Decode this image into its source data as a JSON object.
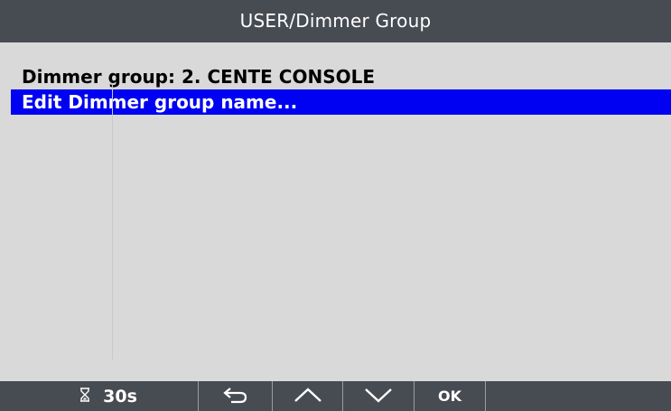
{
  "header": {
    "title": "USER/Dimmer Group"
  },
  "menu": {
    "items": [
      {
        "label": "Dimmer group: 2. CENTE CONSOLE",
        "selected": false
      },
      {
        "label": "Edit Dimmer group name...",
        "selected": true
      }
    ]
  },
  "footer": {
    "timer_icon": "hourglass-icon",
    "timer_value": "30s",
    "back_icon": "back-arrow-icon",
    "up_icon": "chevron-up-icon",
    "down_icon": "chevron-down-icon",
    "ok_label": "OK"
  },
  "colors": {
    "bar_background": "#474b52",
    "content_background": "#d9d9d9",
    "selection_highlight": "#0000f2",
    "separator": "#9a9ca0"
  }
}
